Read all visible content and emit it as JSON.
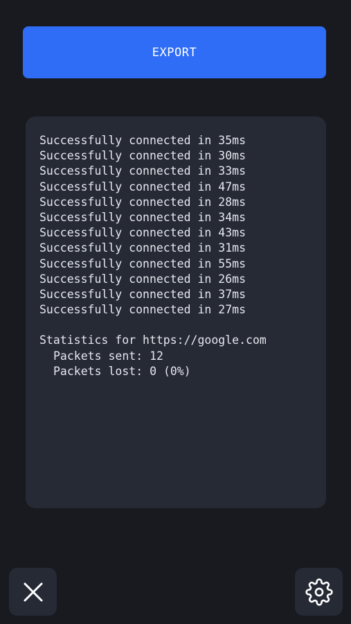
{
  "export_button": {
    "label": "EXPORT"
  },
  "log": {
    "lines": [
      "Successfully connected in 35ms",
      "Successfully connected in 30ms",
      "Successfully connected in 33ms",
      "Successfully connected in 47ms",
      "Successfully connected in 28ms",
      "Successfully connected in 34ms",
      "Successfully connected in 43ms",
      "Successfully connected in 31ms",
      "Successfully connected in 55ms",
      "Successfully connected in 26ms",
      "Successfully connected in 37ms",
      "Successfully connected in 27ms"
    ],
    "stats_header": "Statistics for https://google.com",
    "packets_sent": "Packets sent: 12",
    "packets_lost": "Packets lost: 0 (0%)"
  },
  "footer": {
    "close_icon": "close-icon",
    "settings_icon": "gear-icon"
  },
  "colors": {
    "background": "#181a20",
    "accent": "#2f6df6",
    "panel": "#262a35",
    "text": "#e6e8ee"
  }
}
